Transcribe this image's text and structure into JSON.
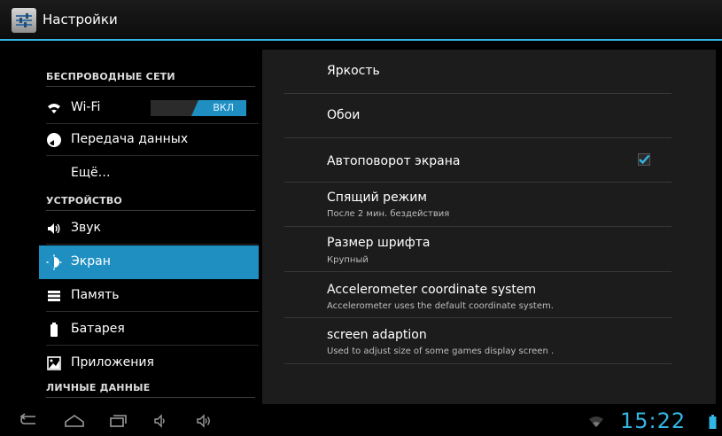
{
  "app": {
    "title": "Настройки"
  },
  "sidebar": {
    "categories": [
      "БЕСПРОВОДНЫЕ СЕТИ",
      "УСТРОЙСТВО",
      "ЛИЧНЫЕ ДАННЫЕ"
    ],
    "items": [
      {
        "label": "Wi-Fi",
        "icon": "wifi-icon"
      },
      {
        "label": "Передача данных",
        "icon": "data-usage-icon"
      },
      {
        "label": "Ещё…",
        "icon": ""
      },
      {
        "label": "Звук",
        "icon": "speaker-icon"
      },
      {
        "label": "Экран",
        "icon": "display-icon",
        "selected": true
      },
      {
        "label": "Память",
        "icon": "storage-icon"
      },
      {
        "label": "Батарея",
        "icon": "battery-icon"
      },
      {
        "label": "Приложения",
        "icon": "apps-icon"
      }
    ],
    "wifi_toggle": {
      "state_label": "ВКЛ"
    }
  },
  "detail": {
    "items": [
      {
        "title": "Яркость",
        "summary": ""
      },
      {
        "title": "Обои",
        "summary": ""
      },
      {
        "title": "Автоповорот экрана",
        "summary": "",
        "checked": true
      },
      {
        "title": "Спящий режим",
        "summary": "После 2 мин. бездействия"
      },
      {
        "title": "Размер шрифта",
        "summary": "Крупный"
      },
      {
        "title": "Accelerometer coordinate system",
        "summary": "Accelerometer uses the default coordinate system."
      },
      {
        "title": "screen adaption",
        "summary": "Used to adjust size of some games display screen ."
      }
    ]
  },
  "statusbar": {
    "time": "15:22"
  },
  "colors": {
    "accent": "#33b5e5",
    "selected": "#1f8fc2"
  }
}
